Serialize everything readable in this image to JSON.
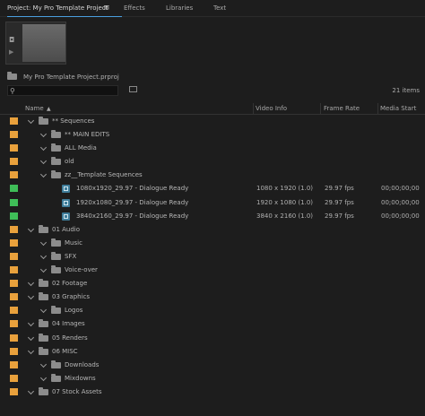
{
  "tabs": [
    {
      "label": "Project: My Pro Template Project",
      "active": true
    },
    {
      "label": "Effects",
      "active": false
    },
    {
      "label": "Libraries",
      "active": false
    },
    {
      "label": "Text",
      "active": false
    }
  ],
  "project": {
    "file_name": "My Pro Template Project.prproj",
    "item_count": "21 items"
  },
  "search": {
    "value": "",
    "placeholder": ""
  },
  "columns": {
    "name": "Name",
    "video_info": "Video Info",
    "frame_rate": "Frame Rate",
    "media_start": "Media Start"
  },
  "colors": {
    "orange_label": "#e9a13c",
    "green_label": "#3fbe58",
    "sequence_icon": "#3f7d9a",
    "accent": "#4a9fe0"
  },
  "rows": [
    {
      "name": "** Sequences",
      "type": "folder",
      "level": 0,
      "label_color": "orange",
      "video_info": "",
      "frame_rate": "",
      "media_start": ""
    },
    {
      "name": "** MAIN EDITS",
      "type": "folder",
      "level": 1,
      "label_color": "orange",
      "video_info": "",
      "frame_rate": "",
      "media_start": ""
    },
    {
      "name": "ALL Media",
      "type": "folder",
      "level": 1,
      "label_color": "orange",
      "video_info": "",
      "frame_rate": "",
      "media_start": ""
    },
    {
      "name": "old",
      "type": "folder",
      "level": 1,
      "label_color": "orange",
      "video_info": "",
      "frame_rate": "",
      "media_start": ""
    },
    {
      "name": "zz__Template Sequences",
      "type": "folder",
      "level": 1,
      "label_color": "orange",
      "video_info": "",
      "frame_rate": "",
      "media_start": ""
    },
    {
      "name": "1080x1920_29.97 - Dialogue Ready",
      "type": "sequence",
      "level": 2,
      "label_color": "green",
      "video_info": "1080 x 1920 (1.0)",
      "frame_rate": "29.97 fps",
      "media_start": "00;00;00;00"
    },
    {
      "name": "1920x1080_29.97 - Dialogue Ready",
      "type": "sequence",
      "level": 2,
      "label_color": "green",
      "video_info": "1920 x 1080 (1.0)",
      "frame_rate": "29.97 fps",
      "media_start": "00;00;00;00"
    },
    {
      "name": "3840x2160_29.97 - Dialogue Ready",
      "type": "sequence",
      "level": 2,
      "label_color": "green",
      "video_info": "3840 x 2160 (1.0)",
      "frame_rate": "29.97 fps",
      "media_start": "00;00;00;00"
    },
    {
      "name": "01 Audio",
      "type": "folder",
      "level": 0,
      "label_color": "orange",
      "video_info": "",
      "frame_rate": "",
      "media_start": ""
    },
    {
      "name": "Music",
      "type": "folder",
      "level": 1,
      "label_color": "orange",
      "video_info": "",
      "frame_rate": "",
      "media_start": ""
    },
    {
      "name": "SFX",
      "type": "folder",
      "level": 1,
      "label_color": "orange",
      "video_info": "",
      "frame_rate": "",
      "media_start": ""
    },
    {
      "name": "Voice-over",
      "type": "folder",
      "level": 1,
      "label_color": "orange",
      "video_info": "",
      "frame_rate": "",
      "media_start": ""
    },
    {
      "name": "02 Footage",
      "type": "folder",
      "level": 0,
      "label_color": "orange",
      "video_info": "",
      "frame_rate": "",
      "media_start": ""
    },
    {
      "name": "03 Graphics",
      "type": "folder",
      "level": 0,
      "label_color": "orange",
      "video_info": "",
      "frame_rate": "",
      "media_start": ""
    },
    {
      "name": "Logos",
      "type": "folder",
      "level": 1,
      "label_color": "orange",
      "video_info": "",
      "frame_rate": "",
      "media_start": ""
    },
    {
      "name": "04 Images",
      "type": "folder",
      "level": 0,
      "label_color": "orange",
      "video_info": "",
      "frame_rate": "",
      "media_start": ""
    },
    {
      "name": "05 Renders",
      "type": "folder",
      "level": 0,
      "label_color": "orange",
      "video_info": "",
      "frame_rate": "",
      "media_start": ""
    },
    {
      "name": "06 MISC",
      "type": "folder",
      "level": 0,
      "label_color": "orange",
      "video_info": "",
      "frame_rate": "",
      "media_start": ""
    },
    {
      "name": "Downloads",
      "type": "folder",
      "level": 1,
      "label_color": "orange",
      "video_info": "",
      "frame_rate": "",
      "media_start": ""
    },
    {
      "name": "Mixdowns",
      "type": "folder",
      "level": 1,
      "label_color": "orange",
      "video_info": "",
      "frame_rate": "",
      "media_start": ""
    },
    {
      "name": "07 Stock Assets",
      "type": "folder",
      "level": 0,
      "label_color": "orange",
      "video_info": "",
      "frame_rate": "",
      "media_start": ""
    }
  ]
}
